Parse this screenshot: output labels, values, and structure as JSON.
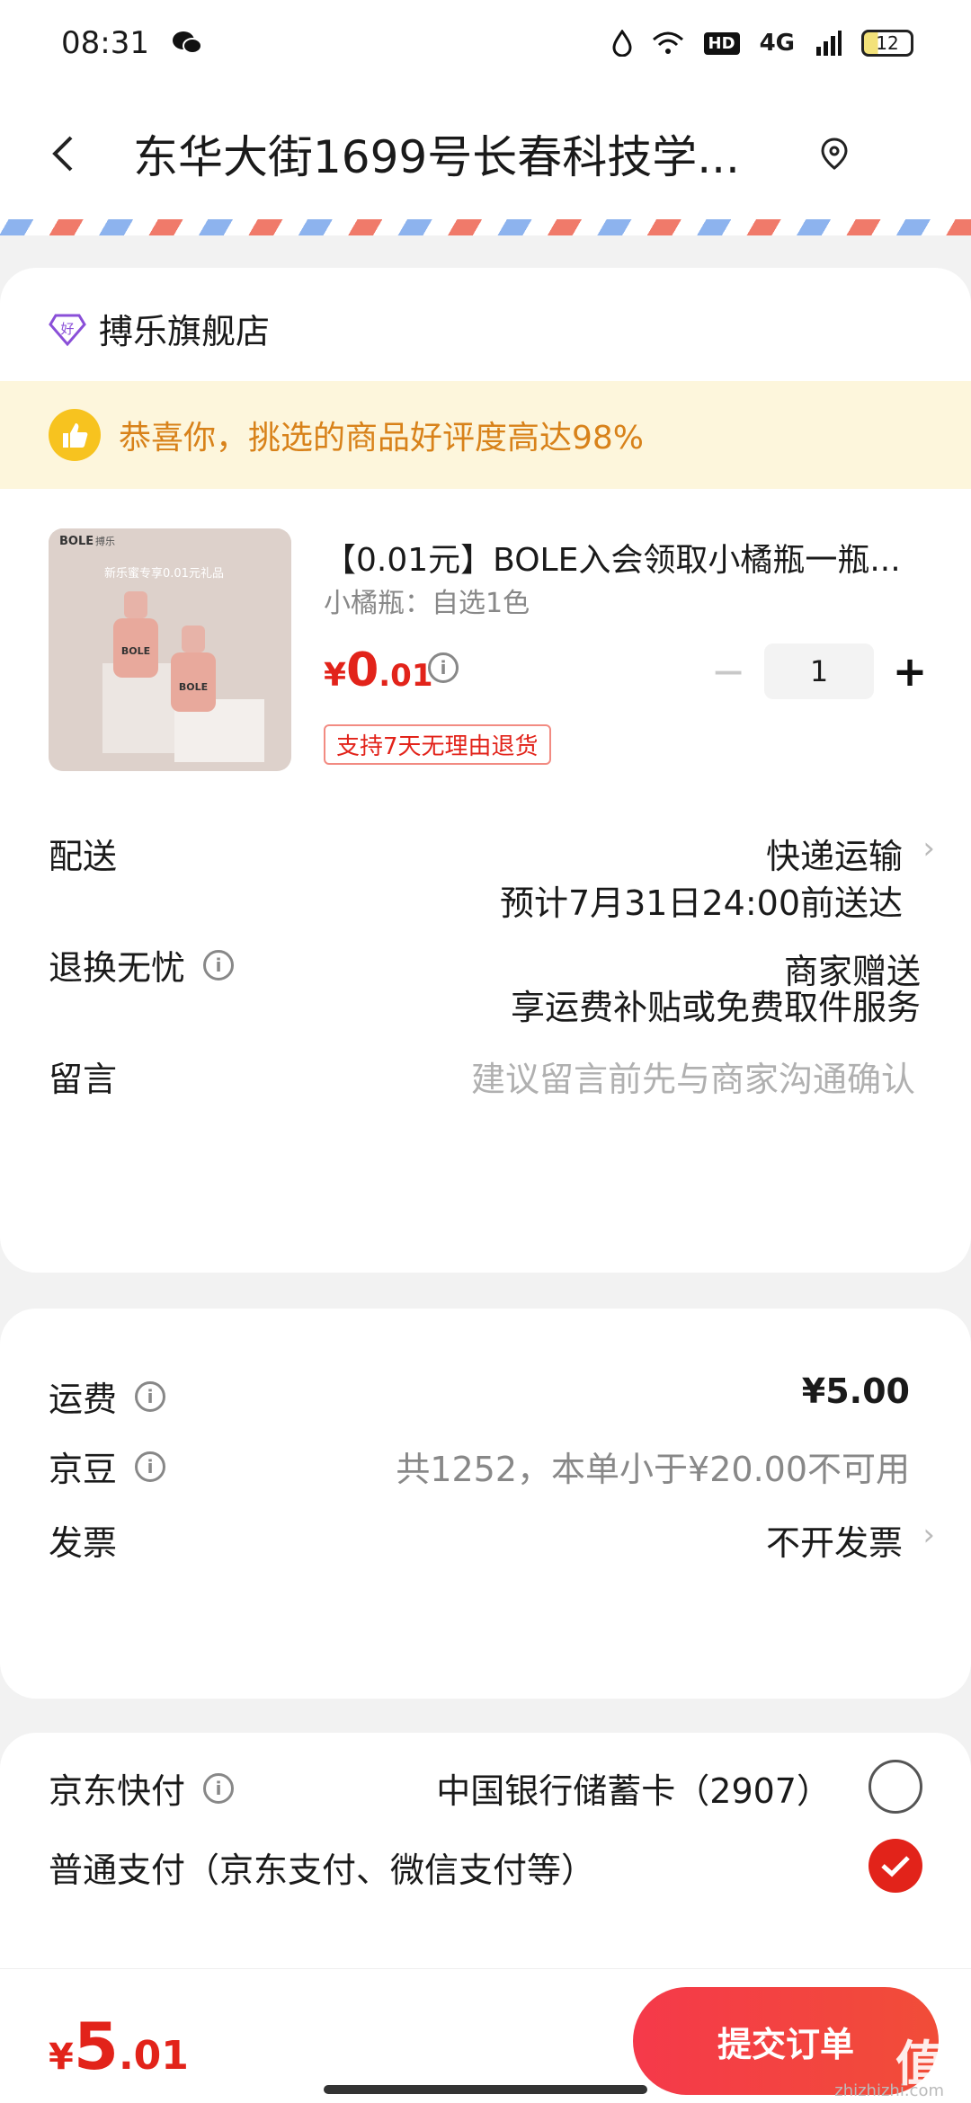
{
  "status_bar": {
    "time": "08:31",
    "network": "4G",
    "hd": "HD",
    "battery": "12"
  },
  "header": {
    "address": "东华大街1699号长春科技学..."
  },
  "store": {
    "name": "搏乐旗舰店",
    "badge_glyph": "好",
    "banner_text": "恭喜你，挑选的商品好评度高达98%"
  },
  "product": {
    "title": "【0.01元】BOLE入会领取小橘瓶一瓶...",
    "spec": "小橘瓶：自选1色",
    "price_currency": "¥",
    "price_int": "0",
    "price_dec": ".01",
    "quantity": "1",
    "return_policy": "支持7天无理由退货",
    "image_brand": "BOLE",
    "image_brand_cn": "搏乐",
    "image_caption": "新乐蜜专享0.01元礼品"
  },
  "delivery": {
    "label": "配送",
    "method": "快递运输",
    "eta": "预计7月31日24:00前送达"
  },
  "returns": {
    "label": "退换无忧",
    "value": "商家赠送",
    "detail": "享运费补贴或免费取件服务"
  },
  "message": {
    "label": "留言",
    "placeholder": "建议留言前先与商家沟通确认"
  },
  "fees": {
    "shipping_label": "运费",
    "shipping_value": "¥5.00",
    "beans_label": "京豆",
    "beans_value": "共1252，本单小于¥20.00不可用",
    "invoice_label": "发票",
    "invoice_value": "不开发票"
  },
  "payment": {
    "quickpay_label": "京东快付",
    "quickpay_card": "中国银行储蓄卡（2907）",
    "normal_label": "普通支付（京东支付、微信支付等）",
    "selected": "normal"
  },
  "footer": {
    "total_currency": "¥",
    "total_int": "5",
    "total_dec": ".01",
    "submit_label": "提交订单",
    "watermark": "值",
    "watermark_sub": "zhizhizhi.com"
  },
  "colors": {
    "accent": "#e2231a",
    "banner_bg": "#fdf6dc",
    "banner_text": "#d8821a"
  }
}
